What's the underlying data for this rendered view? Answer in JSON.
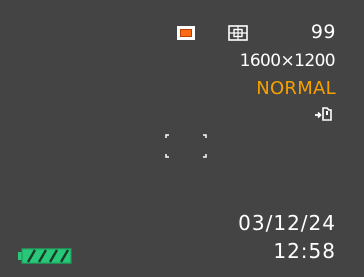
{
  "screen": {
    "background": "#444444",
    "icons": {
      "shot_mode": "single-shot-icon",
      "metering": "metering-icon",
      "record_mode": "flash-memory-icon",
      "battery": "battery-full-icon"
    },
    "remaining_shots": "99",
    "image_size": "1600×1200",
    "quality": "NORMAL",
    "date": "03/12/24",
    "time": "12:58",
    "battery_level": 1.0
  },
  "colors": {
    "accent_orange": "#ff6a14",
    "quality_text": "#f5a000",
    "battery_fill": "#28c878"
  }
}
